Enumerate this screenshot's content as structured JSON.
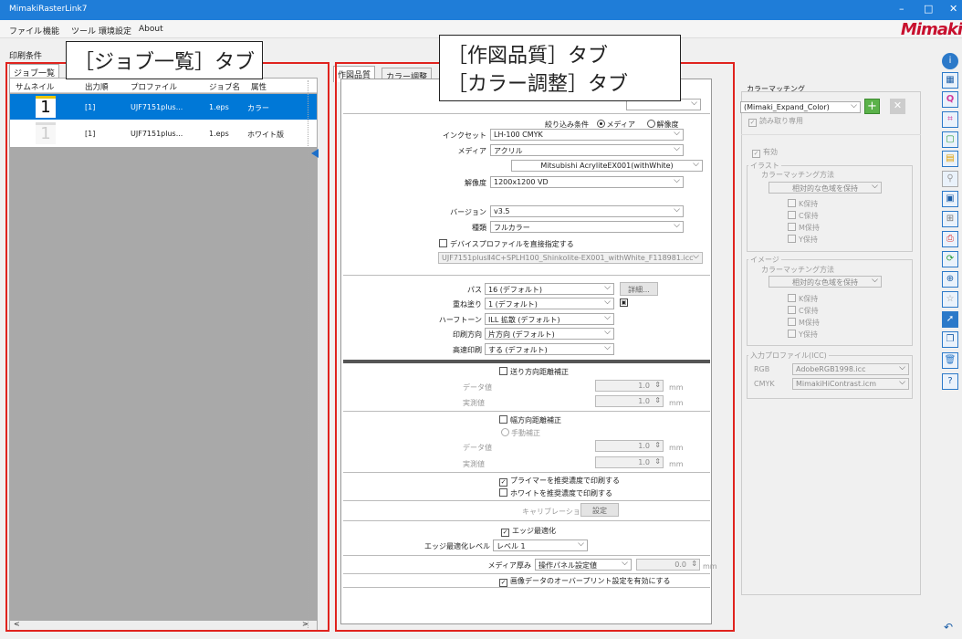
{
  "window": {
    "title": "MimakiRasterLink7",
    "minimize": "–",
    "maximize": "□",
    "close": "✕"
  },
  "menu": [
    "ファイル",
    "機能",
    "ツール",
    "環境設定",
    "About"
  ],
  "logo": "Mimaki",
  "print_conditions_label": "印刷条件",
  "job_list": {
    "tab": "ジョブ一覧",
    "columns": [
      "サムネイル",
      "出力順",
      "プロファイル",
      "ジョブ名",
      "属性"
    ],
    "rows": [
      {
        "thumb": "1",
        "order": "[1]",
        "profile": "UJF7151plus...",
        "job": "1.eps",
        "attr": "カラー"
      },
      {
        "thumb": "1",
        "order": "[1]",
        "profile": "UJF7151plus...",
        "job": "1.eps",
        "attr": "ホワイト版"
      }
    ],
    "scroll_left": "<",
    "scroll_right": ">"
  },
  "callouts": {
    "job_tab": "［ジョブ一覧］タブ",
    "quality_tab": "［作図品質］タブ",
    "color_tab": "［カラー調整］タブ"
  },
  "quality": {
    "tabs": [
      "作図品質",
      "カラー調整"
    ],
    "filter_label": "絞り込み条件",
    "filter_media": "メディア",
    "filter_resolution": "解像度",
    "inkset_label": "インクセット",
    "inkset": "LH-100 CMYK",
    "media_label": "メディア",
    "media": "アクリル",
    "media_detail": "Mitsubishi AcryliteEX001(withWhite)",
    "resolution_label": "解像度",
    "resolution": "1200x1200 VD",
    "version_label": "バージョン",
    "version": "v3.5",
    "type_label": "種類",
    "type": "フルカラー",
    "device_profile_label": "デバイスプロファイルを直接指定する",
    "device_profile": "UJF7151plusⅡ4C+SPLH100_Shinkolite-EX001_withWhite_F118981.icc",
    "pass_label": "パス",
    "pass": "16 (デフォルト)",
    "detail_btn": "詳細...",
    "overcoat_label": "重ね塗り",
    "overcoat": "1 (デフォルト)",
    "halftone_label": "ハーフトーン",
    "halftone": "ILL 拡散 (デフォルト)",
    "direction_label": "印刷方向",
    "direction": "片方向 (デフォルト)",
    "highspeed_label": "高速印刷",
    "highspeed": "する (デフォルト)",
    "feed_corr_label": "送り方向距離補正",
    "data_val_label": "データ値",
    "actual_val_label": "実測値",
    "feed_data": "1.0",
    "feed_actual": "1.0",
    "unit": "mm",
    "width_corr_label": "幅方向距離補正",
    "manual_corr_label": "手動補正",
    "width_data": "1.0",
    "width_actual": "1.0",
    "primer_label": "プライマーを推奨濃度で印刷する",
    "white_label": "ホワイトを推奨濃度で印刷する",
    "calib_label": "キャリブレーション",
    "calib_btn": "設定",
    "edge_opt_label": "エッジ最適化",
    "edge_level_label": "エッジ最適化レベル",
    "edge_level": "レベル 1",
    "thickness_label": "メディア厚み",
    "thickness": "操作パネル設定値",
    "thickness_val": "0.0",
    "overprint_label": "画像データのオーバープリント設定を有効にする"
  },
  "color_matching": {
    "title": "カラーマッチング",
    "profile": "(Mimaki_Expand_Color)",
    "readonly": "読み取り専用",
    "enabled": "有効",
    "illust": "イラスト",
    "method": "カラーマッチング方法",
    "method_val": "相対的な色域を保持",
    "keep": [
      "K保持",
      "C保持",
      "M保持",
      "Y保持"
    ],
    "image": "イメージ",
    "input_profile": "入力プロファイル(ICC)",
    "rgb_label": "RGB",
    "rgb": "AdobeRGB1998.icc",
    "cmyk_label": "CMYK",
    "cmyk": "MimakiHiContrast.icm"
  },
  "accent": {
    "titlebar": "#1f7dd8",
    "highlight": "#0078d7",
    "callout_box": "#e0231e"
  }
}
